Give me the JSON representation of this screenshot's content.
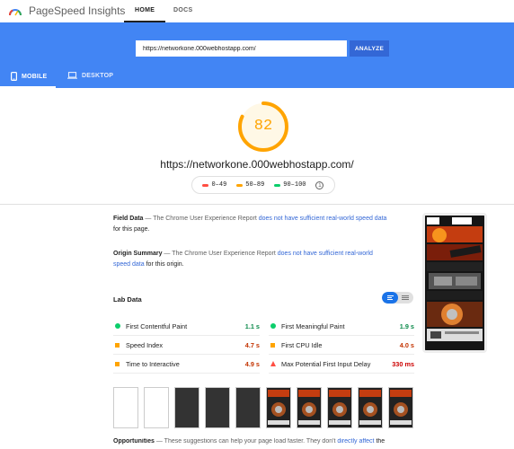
{
  "header": {
    "app_title": "PageSpeed Insights",
    "tabs": [
      {
        "label": "HOME",
        "active": true
      },
      {
        "label": "DOCS",
        "active": false
      }
    ]
  },
  "search": {
    "value": "https://networkone.000webhostapp.com/",
    "button_label": "ANALYZE"
  },
  "device_tabs": [
    {
      "label": "MOBILE",
      "icon": "mobile-phone-icon",
      "active": true
    },
    {
      "label": "DESKTOP",
      "icon": "laptop-icon",
      "active": false
    }
  ],
  "score": {
    "value": "82",
    "fraction": 0.82,
    "color": "#ffa400",
    "url": "https://networkone.000webhostapp.com/"
  },
  "legend": [
    {
      "label": "0–49",
      "color": "#ff4e42"
    },
    {
      "label": "50–89",
      "color": "#ffa400"
    },
    {
      "label": "90–100",
      "color": "#0cce6b"
    }
  ],
  "field_data": {
    "title": "Field Data",
    "text_before": "The Chrome User Experience Report",
    "link": "does not have sufficient real-world speed data",
    "text_after": "for this page."
  },
  "origin_summary": {
    "title": "Origin Summary",
    "text_before": "The Chrome User Experience Report",
    "link": "does not have sufficient real-world speed data",
    "text_after": "for this origin."
  },
  "lab_data": {
    "title": "Lab Data",
    "metrics_left": [
      {
        "name": "First Contentful Paint",
        "value": "1.1 s",
        "status": "pass",
        "color": "#0cce6b"
      },
      {
        "name": "Speed Index",
        "value": "4.7 s",
        "status": "average",
        "color": "#e67700"
      },
      {
        "name": "Time to Interactive",
        "value": "4.9 s",
        "status": "average",
        "color": "#e67700"
      }
    ],
    "metrics_right": [
      {
        "name": "First Meaningful Paint",
        "value": "1.9 s",
        "status": "pass",
        "color": "#0cce6b"
      },
      {
        "name": "First CPU Idle",
        "value": "4.0 s",
        "status": "average",
        "color": "#e67700"
      },
      {
        "name": "Max Potential First Input Delay",
        "value": "330 ms",
        "status": "fail",
        "color": "#cc0000"
      }
    ]
  },
  "opportunities": {
    "title": "Opportunities",
    "text": "These suggestions can help your page load faster. They don't",
    "link": "directly affect",
    "text_after": "the"
  }
}
